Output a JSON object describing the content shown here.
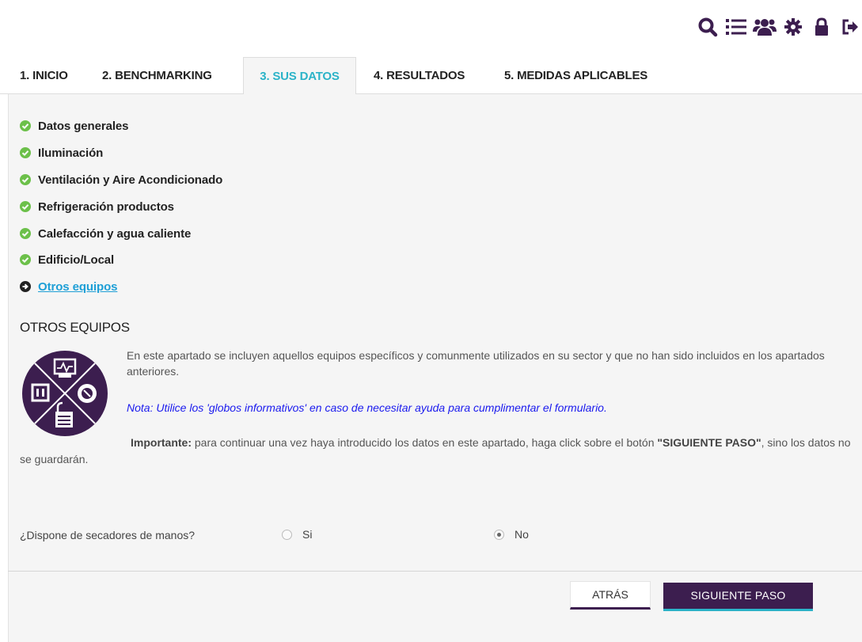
{
  "colors": {
    "accent": "#2bb3c8",
    "brand": "#3c1e4f",
    "check": "#6cc04a",
    "link": "#1e9fd6",
    "note": "#1a1aee"
  },
  "toolbar": {
    "icons": [
      "search-icon",
      "list-icon",
      "users-icon",
      "gear-icon",
      "lock-icon",
      "logout-icon"
    ]
  },
  "tabs": [
    {
      "label": "1. INICIO",
      "active": false
    },
    {
      "label": "2. BENCHMARKING",
      "active": false
    },
    {
      "label": "3. SUS DATOS",
      "active": true
    },
    {
      "label": "4. RESULTADOS",
      "active": false
    },
    {
      "label": "5. MEDIDAS APLICABLES",
      "active": false
    }
  ],
  "steps": [
    {
      "label": "Datos generales",
      "status": "done"
    },
    {
      "label": "Iluminación",
      "status": "done"
    },
    {
      "label": "Ventilación y Aire Acondicionado",
      "status": "done"
    },
    {
      "label": "Refrigeración productos",
      "status": "done"
    },
    {
      "label": "Calefacción y agua caliente",
      "status": "done"
    },
    {
      "label": "Edificio/Local",
      "status": "done"
    },
    {
      "label": "Otros equipos",
      "status": "current"
    }
  ],
  "section": {
    "title": "OTROS EQUIPOS",
    "intro": "En este apartado se incluyen aquellos equipos específicos y comunmente utilizados en su sector y que no han sido incluidos en los apartados anteriores.",
    "note": "Nota: Utilice los 'globos informativos' en caso de necesitar ayuda para cumplimentar el formulario.",
    "important_label": "Importante:",
    "important_text_1": " para continuar una vez haya introducido los datos en este apartado, haga click sobre el botón ",
    "important_button": "\"SIGUIENTE PASO\"",
    "important_text_2": ", sino los datos no se guardarán."
  },
  "question": {
    "label": "¿Dispone de secadores de manos?",
    "options": [
      {
        "label": "Si",
        "checked": false
      },
      {
        "label": "No",
        "checked": true
      }
    ]
  },
  "buttons": {
    "back": "ATRÁS",
    "next": "SIGUIENTE PASO"
  }
}
